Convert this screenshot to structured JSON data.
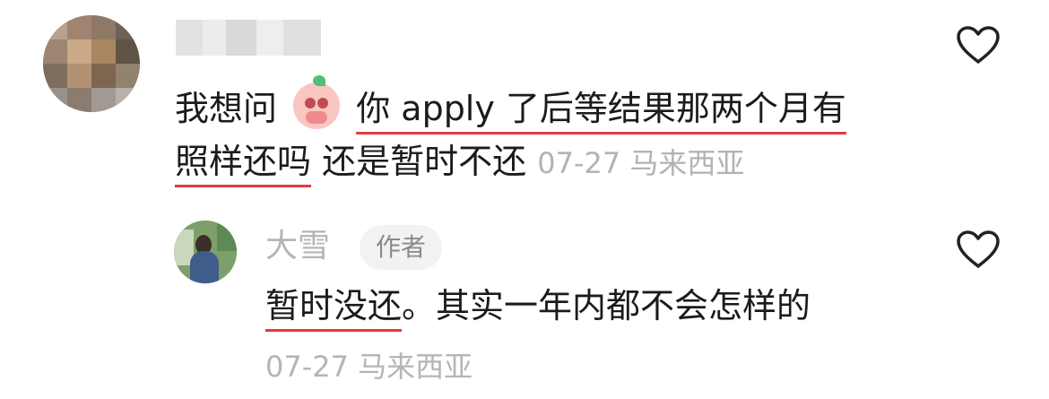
{
  "comment": {
    "line1_prefix": "我想问",
    "line1_underlined": "你 apply 了后等结果那两个月有",
    "line2_underlined": "照样还吗",
    "line2_rest": " 还是暂时不还",
    "meta": "07-27 马来西亚",
    "emoji": "face-with-pleading-eyes-sticker",
    "like_icon": "heart-outline-icon"
  },
  "reply": {
    "name": "大雪",
    "badge": "作者",
    "text_underlined": "暂时没还",
    "text_rest": "。其实一年内都不会怎样的",
    "meta": "07-27 马来西亚",
    "like_icon": "heart-outline-icon"
  },
  "colors": {
    "underline": "#e8373e",
    "meta_text": "#b3b3b3",
    "badge_bg": "#f2f2f2"
  }
}
